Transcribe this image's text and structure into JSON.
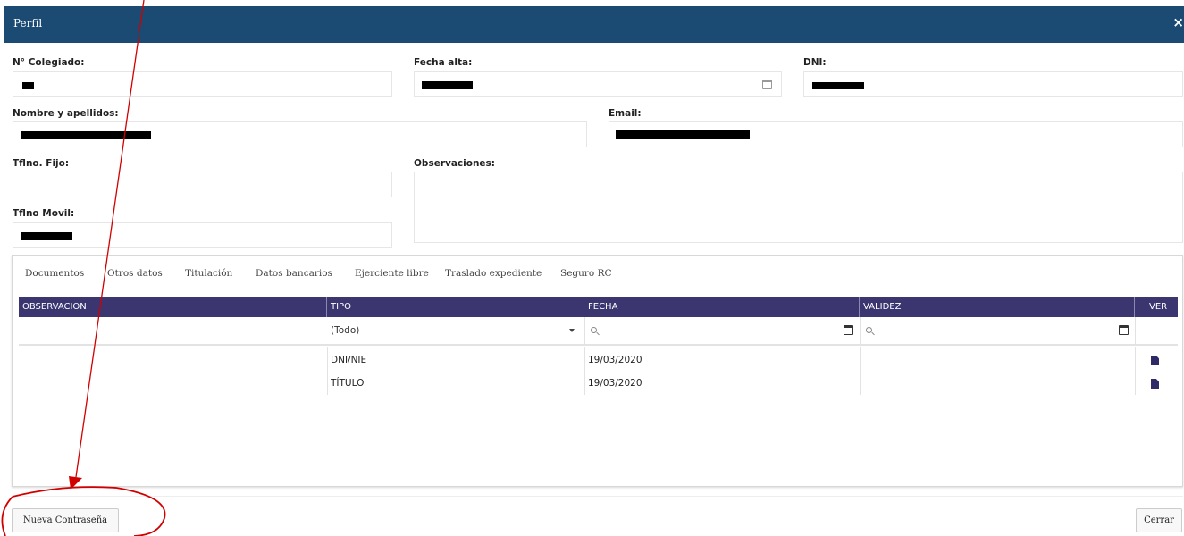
{
  "window": {
    "title": "Perfil",
    "close_label": "×"
  },
  "form": {
    "num_colegiado_label": "N° Colegiado:",
    "fecha_alta_label": "Fecha alta:",
    "dni_label": "DNI:",
    "nombre_label": "Nombre y apellidos:",
    "email_label": "Email:",
    "tfno_fijo_label": "Tflno. Fijo:",
    "observaciones_label": "Observaciones:",
    "tfno_movil_label": "Tflno Movil:"
  },
  "tabs": [
    {
      "label": "Documentos"
    },
    {
      "label": "Otros datos"
    },
    {
      "label": "Titulación"
    },
    {
      "label": "Datos bancarios"
    },
    {
      "label": "Ejerciente libre"
    },
    {
      "label": "Traslado expediente"
    },
    {
      "label": "Seguro RC"
    }
  ],
  "grid": {
    "columns": [
      "OBSERVACION",
      "TIPO",
      "FECHA",
      "VALIDEZ",
      "VER"
    ],
    "filter": {
      "tipo_selected": "(Todo)"
    },
    "rows": [
      {
        "observacion": "",
        "tipo": "DNI/NIE",
        "fecha": "19/03/2020",
        "validez": ""
      },
      {
        "observacion": "",
        "tipo": "TÍTULO",
        "fecha": "19/03/2020",
        "validez": ""
      }
    ]
  },
  "buttons": {
    "new_password": "Nueva Contraseña",
    "close": "Cerrar"
  },
  "colors": {
    "titlebar": "#1b4a73",
    "grid_header": "#3b3570",
    "annotation": "#d10000"
  }
}
